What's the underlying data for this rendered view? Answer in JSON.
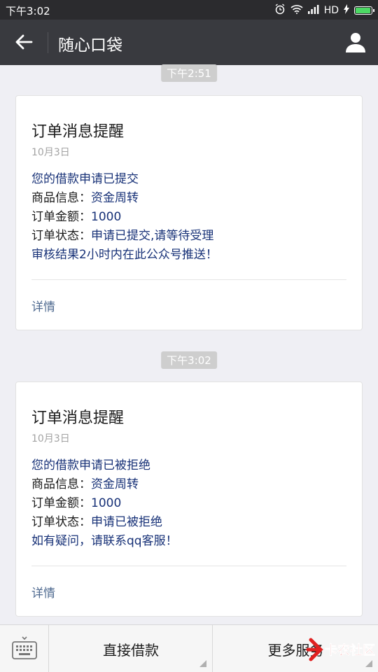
{
  "status_bar": {
    "time": "下午3:02",
    "network": "HD"
  },
  "nav": {
    "title": "随心口袋"
  },
  "messages": [
    {
      "time": "下午2:51",
      "title": "订单消息提醒",
      "date": "10月3日",
      "first": "您的借款申请已提交",
      "product_label": "商品信息：",
      "product_value": "资金周转",
      "amount_label": "订单金额：",
      "amount_value": "1000",
      "status_label": "订单状态：",
      "status_value": "申请已提交,请等待受理",
      "remark": "审核结果2小时内在此公众号推送！",
      "detail": "详情"
    },
    {
      "time": "下午3:02",
      "title": "订单消息提醒",
      "date": "10月3日",
      "first": "您的借款申请已被拒绝",
      "product_label": "商品信息：",
      "product_value": "资金周转",
      "amount_label": "订单金额：",
      "amount_value": "1000",
      "status_label": "订单状态：",
      "status_value": "申请已被拒绝",
      "remark": "如有疑问，请联系qq客服！",
      "detail": "详情"
    }
  ],
  "bottom_menu": {
    "item1": "直接借款",
    "item2": "更多服务"
  },
  "watermark": {
    "text": "卡农社区"
  },
  "colors": {
    "nav_bg": "#393a3f",
    "value_text": "#173177",
    "link_text": "#4f6a90"
  }
}
